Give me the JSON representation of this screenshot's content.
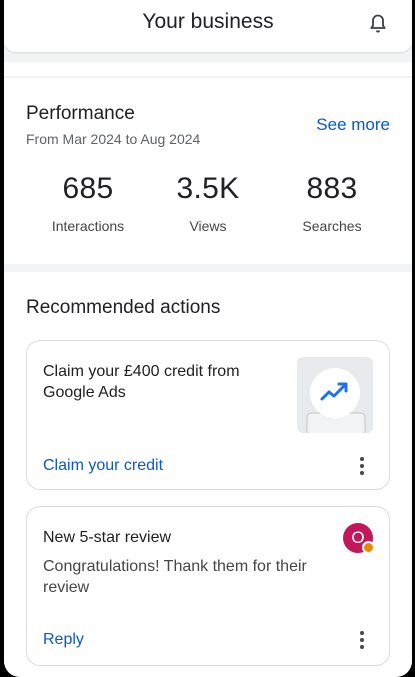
{
  "header": {
    "title": "Your business",
    "notification_icon": "bell-icon"
  },
  "performance": {
    "title": "Performance",
    "date_range": "From Mar 2024 to Aug 2024",
    "see_more_label": "See more",
    "stats": [
      {
        "value": "685",
        "label": "Interactions"
      },
      {
        "value": "3.5K",
        "label": "Views"
      },
      {
        "value": "883",
        "label": "Searches"
      }
    ]
  },
  "recommended": {
    "title": "Recommended actions",
    "cards": [
      {
        "heading": "Claim your £400 credit from Google Ads",
        "action_label": "Claim your credit",
        "illustration": "google-ads-trend-icon"
      },
      {
        "heading": "New 5-star review",
        "body": "Congratulations! Thank them for their review",
        "action_label": "Reply",
        "avatar_letter": "O"
      }
    ]
  },
  "colors": {
    "accent": "#0b57d0",
    "avatar": "#c2185b",
    "badge": "#ea8600"
  }
}
